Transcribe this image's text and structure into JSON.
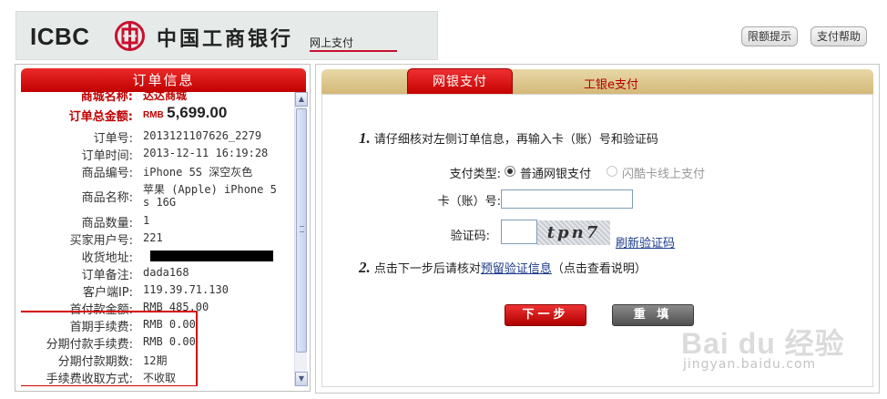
{
  "header": {
    "logo_text": "ICBC",
    "bank_name": "中国工商银行",
    "subtitle": "网上支付",
    "limit_button": "限额提示",
    "help_button": "支付帮助"
  },
  "order": {
    "title": "订单信息",
    "merchant_label": "商城名称:",
    "merchant_value": "达达商城",
    "amount_label": "订单总金额:",
    "amount_currency": "RMB",
    "amount_value": "5,699.00",
    "rows": [
      {
        "label": "订单号:",
        "value": "2013121107626_2279"
      },
      {
        "label": "订单时间:",
        "value": "2013-12-11 16:19:28"
      },
      {
        "label": "商品编号:",
        "value": "iPhone 5S 深空灰色"
      },
      {
        "label": "商品名称:",
        "value": "苹果 (Apple) iPhone 5",
        "value2": "s 16G"
      },
      {
        "label": "商品数量:",
        "value": "1"
      },
      {
        "label": "买家用户号:",
        "value": "221"
      },
      {
        "label": "收货地址:",
        "value": ""
      },
      {
        "label": "订单备注:",
        "value": "dada168"
      },
      {
        "label": "客户端IP:",
        "value": "119.39.71.130"
      },
      {
        "label": "首付款金额:",
        "value": "RMB 485.00"
      },
      {
        "label": "首期手续费:",
        "value": "RMB 0.00"
      },
      {
        "label": "分期付款手续费:",
        "value": "RMB 0.00"
      },
      {
        "label": "分期付款期数:",
        "value": "12期"
      },
      {
        "label": "手续费收取方式:",
        "value": "不收取"
      }
    ]
  },
  "tabs": {
    "active": "网银支付",
    "other": "工银e支付"
  },
  "form": {
    "step1_num": "1.",
    "step1_text": "请仔细核对左侧订单信息，再输入卡（账）号和验证码",
    "pay_type_label": "支付类型:",
    "pay_type_option1": "普通网银支付",
    "pay_type_option2": "闪酷卡线上支付",
    "card_label": "卡（账）号:",
    "card_value": "",
    "captcha_label": "验证码:",
    "captcha_value": "",
    "captcha_image_text": "tpn7",
    "refresh_link": "刷新验证码",
    "step2_num": "2.",
    "step2_prefix": "点击下一步后请核对",
    "step2_link": "预留验证信息",
    "step2_suffix": "（点击查看说明）",
    "next_button": "下一步",
    "reset_button": "重 填"
  },
  "watermark": {
    "main": "Bai du 经验",
    "sub": "jingyan.baidu.com"
  },
  "colors": {
    "brand_red": "#c40000",
    "tab_gold": "#d4b878",
    "link_blue": "#1a3a8a"
  }
}
